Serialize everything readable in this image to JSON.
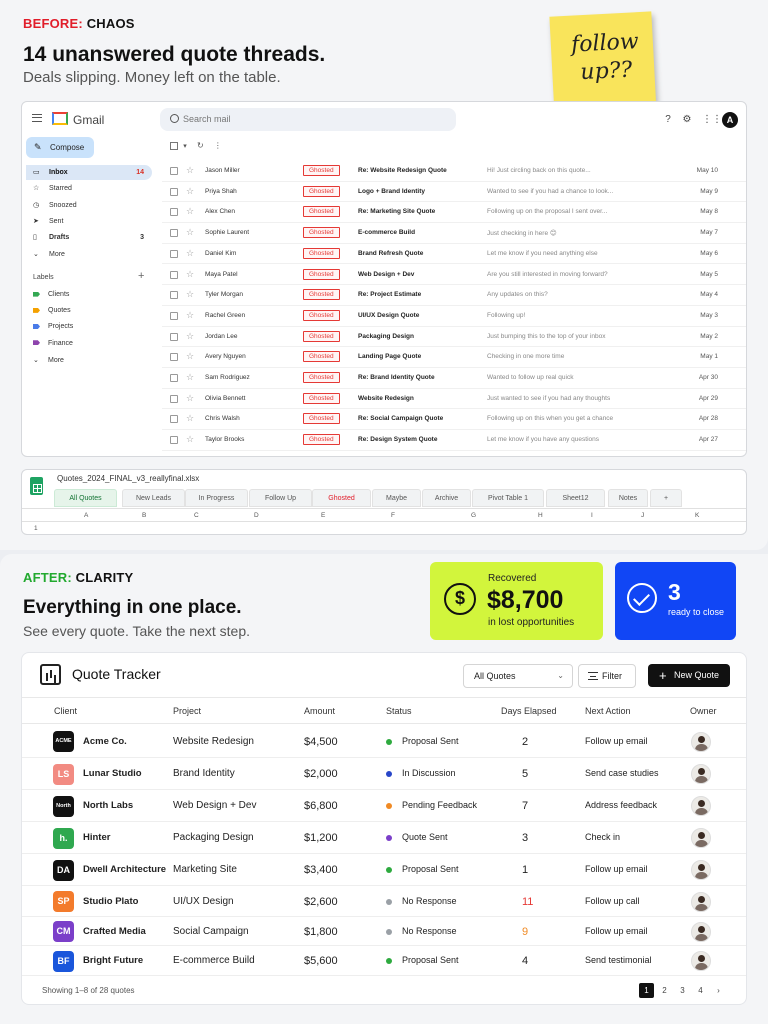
{
  "before": {
    "tag_prefix": "BEFORE:",
    "tag_word": "CHAOS",
    "headline": "14 unanswered quote threads.",
    "subhead": "Deals slipping. Money left on the table.",
    "sticky_note": "follow up??"
  },
  "gmail": {
    "app_name": "Gmail",
    "search_placeholder": "Search mail",
    "compose_label": "Compose",
    "nav": [
      {
        "label": "Inbox",
        "count": "14",
        "icon": "inbox-icon"
      },
      {
        "label": "Starred",
        "count": "",
        "icon": "star-icon"
      },
      {
        "label": "Snoozed",
        "count": "",
        "icon": "clock-icon"
      },
      {
        "label": "Sent",
        "count": "",
        "icon": "send-icon"
      },
      {
        "label": "Drafts",
        "count": "3",
        "icon": "file-icon"
      },
      {
        "label": "More",
        "count": "",
        "icon": "chevron-down-icon"
      }
    ],
    "labels_heading": "Labels",
    "labels": [
      {
        "label": "Clients",
        "color": "#34a853"
      },
      {
        "label": "Quotes",
        "color": "#f4a100"
      },
      {
        "label": "Projects",
        "color": "#4a7be8"
      },
      {
        "label": "Finance",
        "color": "#8e44ad"
      },
      {
        "label": "More",
        "color": ""
      }
    ],
    "ghost_label": "Ghosted",
    "emails": [
      {
        "sender": "Jason Miller",
        "subject": "Re: Website Redesign Quote",
        "preview": "Hi! Just circling back on this quote...",
        "date": "May 10"
      },
      {
        "sender": "Priya Shah",
        "subject": "Logo + Brand Identity",
        "preview": "Wanted to see if you had a chance to look...",
        "date": "May 9"
      },
      {
        "sender": "Alex Chen",
        "subject": "Re: Marketing Site Quote",
        "preview": "Following up on the proposal I sent over...",
        "date": "May 8"
      },
      {
        "sender": "Sophie Laurent",
        "subject": "E-commerce Build",
        "preview": "Just checking in here 😊",
        "date": "May 7"
      },
      {
        "sender": "Daniel Kim",
        "subject": "Brand Refresh Quote",
        "preview": "Let me know if you need anything else",
        "date": "May 6"
      },
      {
        "sender": "Maya Patel",
        "subject": "Web Design + Dev",
        "preview": "Are you still interested in moving forward?",
        "date": "May 5"
      },
      {
        "sender": "Tyler Morgan",
        "subject": "Re: Project Estimate",
        "preview": "Any updates on this?",
        "date": "May 4"
      },
      {
        "sender": "Rachel Green",
        "subject": "UI/UX Design Quote",
        "preview": "Following up!",
        "date": "May 3"
      },
      {
        "sender": "Jordan Lee",
        "subject": "Packaging Design",
        "preview": "Just bumping this to the top of your inbox",
        "date": "May 2"
      },
      {
        "sender": "Avery Nguyen",
        "subject": "Landing Page Quote",
        "preview": "Checking in one more time",
        "date": "May 1"
      },
      {
        "sender": "Sam Rodriguez",
        "subject": "Re: Brand Identity Quote",
        "preview": "Wanted to follow up real quick",
        "date": "Apr 30"
      },
      {
        "sender": "Olivia Bennett",
        "subject": "Website Redesign",
        "preview": "Just wanted to see if you had any thoughts",
        "date": "Apr 29"
      },
      {
        "sender": "Chris Walsh",
        "subject": "Re: Social Campaign Quote",
        "preview": "Following up on this when you get a chance",
        "date": "Apr 28"
      },
      {
        "sender": "Taylor Brooks",
        "subject": "Re: Design System Quote",
        "preview": "Let me know if you have any questions",
        "date": "Apr 27"
      }
    ]
  },
  "sheet": {
    "filename": "Quotes_2024_FINAL_v3_reallyfinal.xlsx",
    "tabs": [
      "All Quotes",
      "New Leads",
      "In Progress",
      "Follow Up",
      "Ghosted",
      "Maybe",
      "Archive",
      "Pivot Table 1",
      "Sheet12",
      "Notes",
      "+"
    ],
    "columns": [
      "A",
      "B",
      "C",
      "D",
      "E",
      "F",
      "G",
      "H",
      "I",
      "J",
      "K"
    ],
    "first_row": "1"
  },
  "after": {
    "tag_prefix": "AFTER:",
    "tag_word": "CLARITY",
    "headline": "Everything in one place.",
    "subhead": "See every quote. Take the next step.",
    "recovered_label": "Recovered",
    "recovered_value": "$8,700",
    "recovered_sub": "in lost opportunities",
    "ready_count": "3",
    "ready_label": "ready to close",
    "accent_lime": "#d2f53c",
    "accent_blue": "#1146f5"
  },
  "tracker": {
    "title": "Quote Tracker",
    "filter_select": "All Quotes",
    "filter_button": "Filter",
    "new_button": "New Quote",
    "headers": [
      "Client",
      "Project",
      "Amount",
      "Status",
      "Days Elapsed",
      "Next Action",
      "Owner"
    ],
    "rows": [
      {
        "logo": "ACME",
        "logo_color": "#111111",
        "client": "Acme Co.",
        "project": "Website Redesign",
        "amount": "$4,500",
        "status": "Proposal Sent",
        "status_color": "#2eaa3f",
        "days": "2",
        "days_color": "#222222",
        "action": "Follow up email"
      },
      {
        "logo": "LS",
        "logo_color": "#f28b82",
        "client": "Lunar Studio",
        "project": "Brand Identity",
        "amount": "$2,000",
        "status": "In Discussion",
        "status_color": "#2846c8",
        "days": "5",
        "days_color": "#222222",
        "action": "Send case studies"
      },
      {
        "logo": "North",
        "logo_color": "#111111",
        "client": "North Labs",
        "project": "Web Design + Dev",
        "amount": "$6,800",
        "status": "Pending Feedback",
        "status_color": "#f08a24",
        "days": "7",
        "days_color": "#222222",
        "action": "Address feedback"
      },
      {
        "logo": "h.",
        "logo_color": "#2fa84f",
        "client": "Hinter",
        "project": "Packaging Design",
        "amount": "$1,200",
        "status": "Quote Sent",
        "status_color": "#7b3fc9",
        "days": "3",
        "days_color": "#222222",
        "action": "Check in"
      },
      {
        "logo": "DA",
        "logo_color": "#111111",
        "client": "Dwell Architecture",
        "project": "Marketing Site",
        "amount": "$3,400",
        "status": "Proposal Sent",
        "status_color": "#2eaa3f",
        "days": "1",
        "days_color": "#222222",
        "action": "Follow up email"
      },
      {
        "logo": "SP",
        "logo_color": "#f37b2c",
        "client": "Studio Plato",
        "project": "UI/UX Design",
        "amount": "$2,600",
        "status": "No Response",
        "status_color": "#9aa0a6",
        "days": "11",
        "days_color": "#e53935",
        "action": "Follow up call"
      },
      {
        "logo": "CM",
        "logo_color": "#7b3fc9",
        "client": "Crafted Media",
        "project": "Social Campaign",
        "amount": "$1,800",
        "status": "No Response",
        "status_color": "#9aa0a6",
        "days": "9",
        "days_color": "#f08a24",
        "action": "Follow up email"
      },
      {
        "logo": "BF",
        "logo_color": "#1a56db",
        "client": "Bright Future",
        "project": "E-commerce Build",
        "amount": "$5,600",
        "status": "Proposal Sent",
        "status_color": "#2eaa3f",
        "days": "4",
        "days_color": "#222222",
        "action": "Send testimonial"
      }
    ],
    "footer": "Showing 1–8 of 28 quotes",
    "pages": [
      "1",
      "2",
      "3",
      "4",
      "›"
    ]
  }
}
